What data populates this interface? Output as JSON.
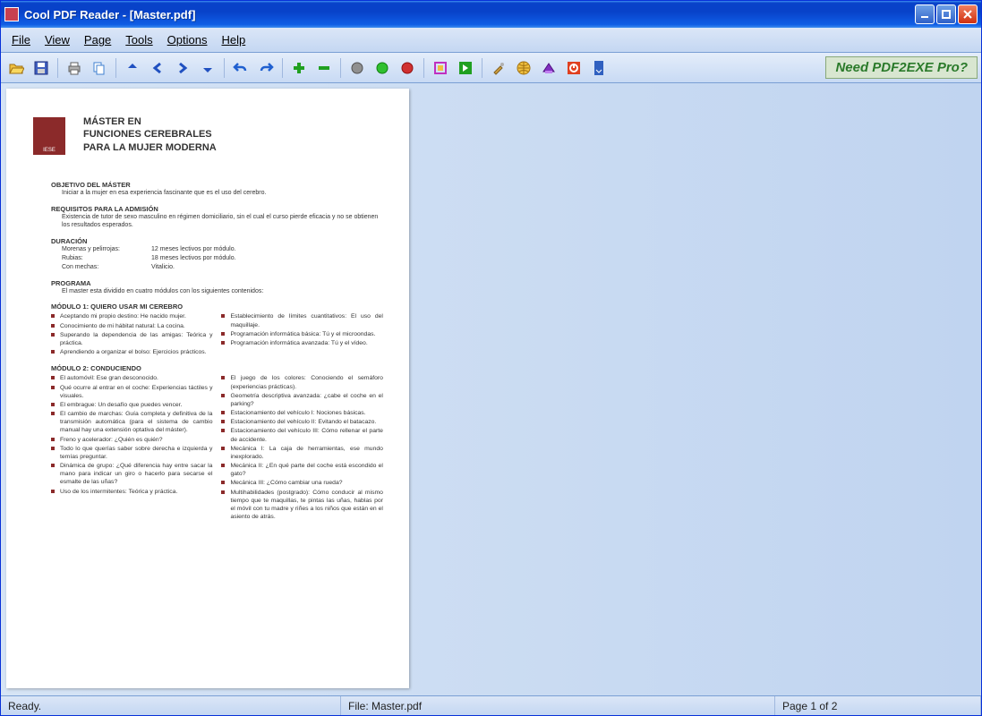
{
  "window": {
    "title": "Cool PDF Reader - [Master.pdf]"
  },
  "menu": {
    "file": "File",
    "view": "View",
    "page": "Page",
    "tools": "Tools",
    "options": "Options",
    "help": "Help"
  },
  "toolbar": {
    "promo": "Need PDF2EXE Pro?"
  },
  "status": {
    "ready": "Ready.",
    "file": "File: Master.pdf",
    "page": "Page 1 of 2"
  },
  "doc": {
    "title_l1": "MÁSTER EN",
    "title_l2": "FUNCIONES CEREBRALES",
    "title_l3": "PARA LA MUJER MODERNA",
    "obj_h": "OBJETIVO DEL MÁSTER",
    "obj_t": "Iniciar a la mujer en esa experiencia fascinante que es el uso del cerebro.",
    "req_h": "REQUISITOS PARA LA ADMISIÓN",
    "req_t": "Existencia de tutor de sexo masculino en régimen domiciliario, sin el cual el curso pierde eficacia y no se obtienen los resultados esperados.",
    "dur_h": "DURACIÓN",
    "dur1_l": "Morenas y pelirrojas:",
    "dur1_v": "12 meses lectivos por módulo.",
    "dur2_l": "Rubias:",
    "dur2_v": "18 meses lectivos por módulo.",
    "dur3_l": "Con mechas:",
    "dur3_v": "Vitalicio.",
    "prog_h": "PROGRAMA",
    "prog_t": "El master esta dividido en cuatro módulos con los siguientes contenidos:",
    "m1_h": "MÓDULO 1: QUIERO USAR MI CEREBRO",
    "m1_a": [
      "Aceptando mi propio destino: He nacido mujer.",
      "Conocimiento de mi hábitat natural: La cocina.",
      "Superando la dependencia de las amigas: Teórica y práctica.",
      "Aprendiendo a organizar el bolso: Ejercicios prácticos."
    ],
    "m1_b": [
      "Establecimiento de límites cuantitativos: El uso del maquillaje.",
      "Programación informática básica: Tú y el microondas.",
      "Programación informática avanzada: Tú y el vídeo."
    ],
    "m2_h": "MÓDULO 2: CONDUCIENDO",
    "m2_a": [
      "El automóvil: Ese gran desconocido.",
      "Qué ocurre al entrar en el coche: Experiencias táctiles y visuales.",
      "El embrague: Un desafío que puedes vencer.",
      "El cambio de marchas: Guía completa y definitiva de la transmisión automática (para el sistema de cambio manual hay una extensión optativa del máster).",
      "Freno y acelerador: ¿Quién es quién?",
      "Todo lo que querías saber sobre derecha e izquierda y temías preguntar.",
      "Dinámica de grupo: ¿Qué diferencia hay entre sacar la mano para indicar un giro o hacerlo para secarse el esmalte de las uñas?",
      "Uso de los intermitentes: Teórica y práctica."
    ],
    "m2_b": [
      "El juego de los colores: Conociendo el semáforo (experiencias prácticas).",
      "Geometría descriptiva avanzada: ¿cabe el coche en el parking?",
      "Estacionamiento del vehículo I: Nociones básicas.",
      "Estacionamiento del vehículo II: Evitando el batacazo.",
      "Estacionamiento del vehículo III: Cómo rellenar el parte de accidente.",
      "Mecánica I: La caja de herramientas, ese mundo inexplorado.",
      "Mecánica II: ¿En qué parte del coche está escondido el gato?",
      "Mecánica III: ¿Cómo cambiar una rueda?",
      "Multihabilidades (postgrado): Cómo conducir al mismo tiempo que te maquillas, te pintas las uñas, hablas por el móvil con tu madre y riñes a los niños que están en el asiento de atrás."
    ]
  }
}
